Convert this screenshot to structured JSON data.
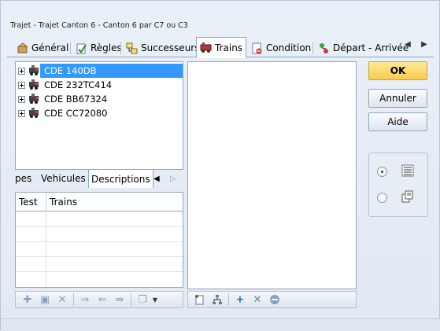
{
  "window": {
    "title": "Trajet - Trajet Canton 6 - Canton 6 par C7 ou C3"
  },
  "tabs": [
    {
      "label": "Général",
      "icon": "general-icon"
    },
    {
      "label": "Règles",
      "icon": "rules-icon"
    },
    {
      "label": "Successeurs",
      "icon": "successors-icon"
    },
    {
      "label": "Trains",
      "icon": "trains-icon",
      "active": true
    },
    {
      "label": "Condition",
      "icon": "condition-icon"
    },
    {
      "label": "Départ - Arrivée",
      "icon": "departure-arrival-icon"
    }
  ],
  "tree": {
    "items": [
      {
        "label": "CDE 140DB",
        "selected": true
      },
      {
        "label": "CDE 232TC414"
      },
      {
        "label": "CDE BB67324"
      },
      {
        "label": "CDE CC72080"
      }
    ]
  },
  "subtabs": [
    {
      "label": "pes"
    },
    {
      "label": "Vehicules"
    },
    {
      "label": "Descriptions",
      "active": true
    }
  ],
  "grid": {
    "columns": [
      "Test",
      "Trains"
    ]
  },
  "buttons": {
    "ok": "OK",
    "cancel": "Annuler",
    "help": "Aide"
  },
  "view_options": {
    "selected": "list"
  },
  "colors": {
    "selection": "#3399ff",
    "ok_button": "#f8cc4c",
    "border": "#8ea6c3"
  }
}
